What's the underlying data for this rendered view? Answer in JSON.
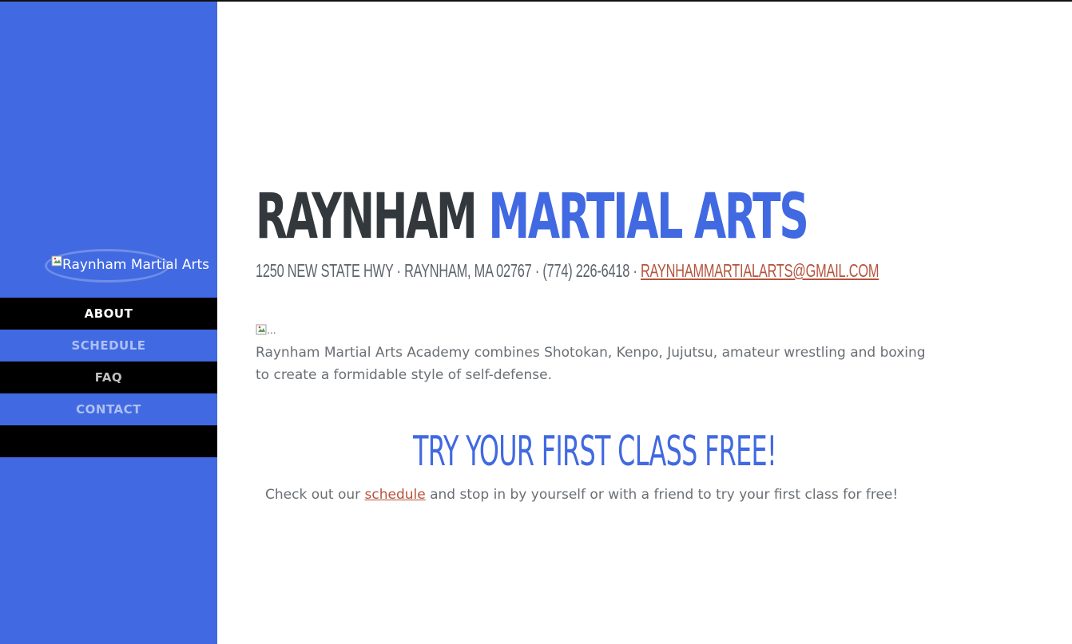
{
  "colors": {
    "sidebar_bg": "#4169e1",
    "nav_dark_bg": "#000000",
    "title_dark": "#33383d",
    "accent_blue": "#4169e1",
    "link_red": "#b5533c",
    "body_text": "#6a6f74"
  },
  "sidebar": {
    "logo_alt": "Raynham Martial Arts",
    "logo_icon": "broken-image-icon",
    "nav": [
      {
        "label": "ABOUT"
      },
      {
        "label": "SCHEDULE"
      },
      {
        "label": "FAQ"
      },
      {
        "label": "CONTACT"
      },
      {
        "label": ""
      }
    ]
  },
  "header": {
    "title_part1": "RAYNHAM",
    "title_part2": "MARTIAL ARTS",
    "address": "1250 NEW STATE HWY · RAYNHAM, MA 02767 · (774) 226-6418 · ",
    "email": "RAYNHAMMARTIALARTS@GMAIL.COM"
  },
  "main": {
    "image_alt": "...",
    "image_icon": "broken-image-icon",
    "intro": "Raynham Martial Arts Academy combines Shotokan, Kenpo, Jujutsu, amateur wrestling and boxing to create a formidable style of self-defense.",
    "cta_title": "TRY YOUR FIRST CLASS FREE!",
    "cta_text_before": "Check out our ",
    "cta_link": "schedule",
    "cta_text_after": " and stop in by yourself or with a friend to try your first class for free!"
  }
}
